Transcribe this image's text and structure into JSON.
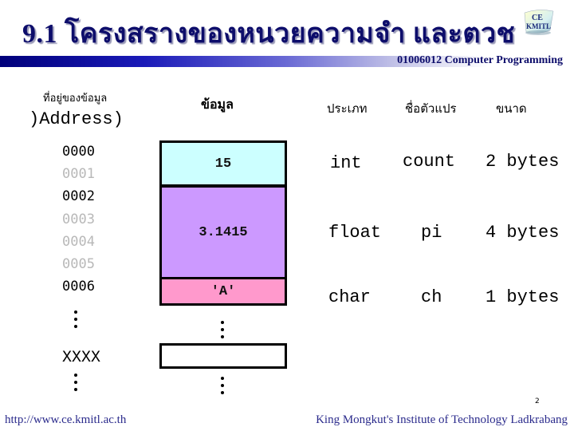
{
  "slide": {
    "title": "9.1 โครงสร้างของหน่วยความจำ และตัวแปร",
    "title_as_rendered": "9.1 โครงสรางของหนวยความจำ และตวช",
    "course": "01006012 Computer Programming",
    "logo_text": [
      "CE",
      "KMITL"
    ],
    "page_number": "2"
  },
  "headers": {
    "address_th": "ที่อยู่ของข้อมูล",
    "address_en": ")Address)",
    "data": "ข้อมูล",
    "type": "ประเภท",
    "variable_name": "ชื่อตัวแปร",
    "size": "ขนาด"
  },
  "addresses": [
    {
      "label": "0000",
      "dim": false
    },
    {
      "label": "0001",
      "dim": true
    },
    {
      "label": "0002",
      "dim": false
    },
    {
      "label": "0003",
      "dim": true
    },
    {
      "label": "0004",
      "dim": true
    },
    {
      "label": "0005",
      "dim": true
    },
    {
      "label": "0006",
      "dim": false
    }
  ],
  "address_unknown": "XXXX",
  "memory_cells": [
    {
      "value": "15",
      "color": "#ccffff",
      "bytes": 2
    },
    {
      "value": "3.1415",
      "color": "#cc99ff",
      "bytes": 4
    },
    {
      "value": "'A'",
      "color": "#ff99cc",
      "bytes": 1
    },
    {
      "value": "",
      "color": "#ffffff",
      "bytes": 1
    }
  ],
  "variables": [
    {
      "type": "int",
      "name": "count",
      "size": "2 bytes"
    },
    {
      "type": "float",
      "name": "pi",
      "size": "4 bytes"
    },
    {
      "type": "char",
      "name": "ch",
      "size": "1 bytes"
    }
  ],
  "footer": {
    "url": "http://www.ce.kmitl.ac.th",
    "institute": "King Mongkut's Institute of Technology Ladkrabang"
  },
  "colors": {
    "title": "#0d0d6b",
    "footer_text": "#2b2b8c",
    "banner_start": "#00007a",
    "address_dim": "#b8b8b8"
  }
}
